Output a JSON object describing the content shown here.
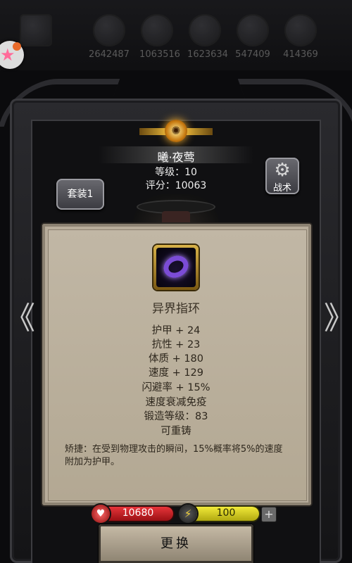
{
  "top_stats": [
    "2642487",
    "1063516",
    "1623634",
    "547409",
    "414369"
  ],
  "hero": {
    "name": "曦·夜莺",
    "level_text": "等级：10",
    "score_text": "评分：10063"
  },
  "buttons": {
    "suit_label": "套装1",
    "tactic_label": "战术",
    "replace_label": "更换",
    "plus_label": "+"
  },
  "nav": {
    "prev_glyph": "《",
    "next_glyph": "》"
  },
  "item": {
    "name": "异界指环",
    "stats": [
      "护甲 + 24",
      "抗性 + 23",
      "体质 + 180",
      "速度 + 129",
      "闪避率 + 15%",
      "速度衰减免疫",
      "锻造等级：83",
      "可重铸"
    ],
    "description": "矫捷：在受到物理攻击的瞬间，15%概率将5%的速度附加为护甲。"
  },
  "resources": {
    "hp": "10680",
    "energy": "100"
  },
  "icons": {
    "hp": "heart-icon",
    "energy": "lightning-icon",
    "tactic": "gear-icon",
    "emblem": "sun-emblem-icon"
  },
  "colors": {
    "hp_bar": "#d8262c",
    "energy_bar": "#e6dc2a",
    "parchment": "#b9ae9b",
    "ring": "#7b4cd6"
  }
}
